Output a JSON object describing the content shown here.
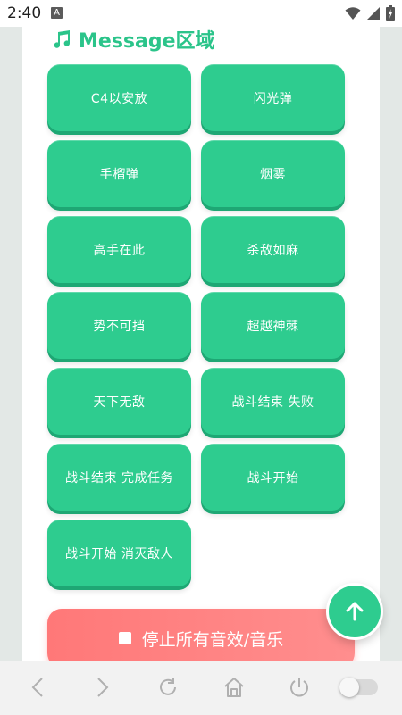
{
  "status": {
    "time": "2:40",
    "badge": "A"
  },
  "section": {
    "title": "Message区域",
    "icon": "music-note-icon"
  },
  "buttons": [
    "C4以安放",
    "闪光弹",
    "手榴弹",
    "烟雾",
    "高手在此",
    "杀敌如麻",
    "势不可挡",
    "超越神棘",
    "天下无敌",
    "战斗结束 失败",
    "战斗结束 完成任务",
    "战斗开始",
    "战斗开始 消灭敌人"
  ],
  "stop_button": {
    "label": "停止所有音效/音乐"
  },
  "colors": {
    "accent": "#2ecc8f",
    "accent_shadow": "#1ea774",
    "title": "#2bc48a",
    "stop": "#ff7878"
  },
  "bottom_nav": {
    "items": [
      "back-icon",
      "forward-icon",
      "refresh-icon",
      "home-icon",
      "power-icon",
      "toggle-switch"
    ],
    "toggle_on": false
  }
}
